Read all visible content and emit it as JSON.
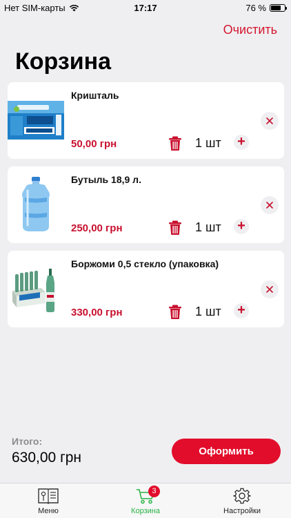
{
  "status_bar": {
    "carrier": "Нет SIM-карты",
    "time": "17:17",
    "battery": "76 %",
    "battery_level": 0.76
  },
  "header": {
    "clear_label": "Очистить",
    "title": "Корзина"
  },
  "cart": {
    "items": [
      {
        "name": "Кришталь",
        "price": "50,00 грн",
        "quantity": "1 шт",
        "image": "water-box-image"
      },
      {
        "name": "Бутыль 18,9 л.",
        "price": "250,00 грн",
        "quantity": "1 шт",
        "image": "water-bottle-image"
      },
      {
        "name": "Боржоми 0,5 стекло (упаковка)",
        "price": "330,00 грн",
        "quantity": "1 шт",
        "image": "borjomi-pack-image"
      }
    ]
  },
  "footer": {
    "total_label": "Итого:",
    "total_value": "630,00 грн",
    "checkout_label": "Оформить"
  },
  "tab_bar": {
    "tabs": [
      {
        "label": "Меню",
        "icon": "menu-book-icon"
      },
      {
        "label": "Корзина",
        "icon": "cart-icon",
        "badge": "3"
      },
      {
        "label": "Настройки",
        "icon": "gear-icon"
      }
    ]
  },
  "colors": {
    "accent": "#e20d2b",
    "price": "#c8102e",
    "active_tab": "#27b244",
    "background": "#efeff1"
  }
}
